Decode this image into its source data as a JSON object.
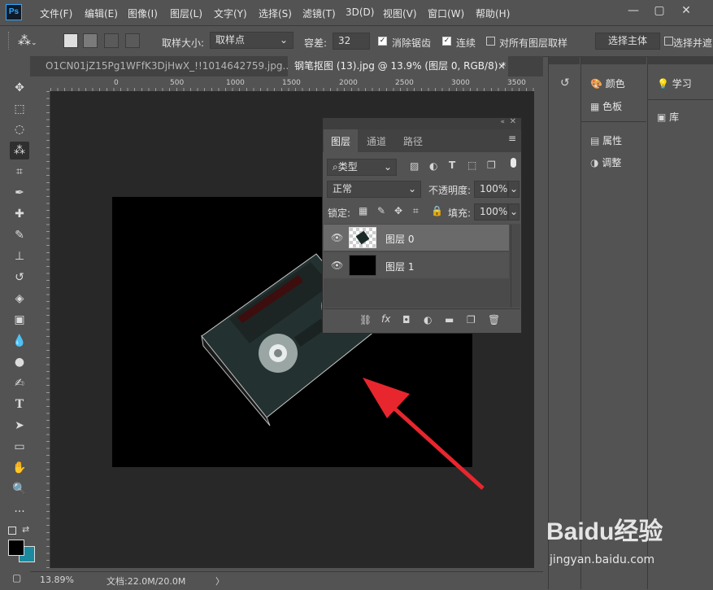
{
  "app": {
    "logo": "Ps"
  },
  "menu": [
    "文件(F)",
    "编辑(E)",
    "图像(I)",
    "图层(L)",
    "文字(Y)",
    "选择(S)",
    "滤镜(T)",
    "3D(D)",
    "视图(V)",
    "窗口(W)",
    "帮助(H)"
  ],
  "window_controls": {
    "minimize": "—",
    "restore": "▢",
    "close": "✕"
  },
  "options": {
    "sample_size_label": "取样大小:",
    "sample_size_value": "取样点",
    "tolerance_label": "容差:",
    "tolerance_value": "32",
    "antialias_label": "消除锯齿",
    "contiguous_label": "连续",
    "sample_all_label": "对所有图层取样",
    "select_subject": "选择主体",
    "select_mask": "选择并遮"
  },
  "tabs": [
    {
      "label": "O1CN01jZ15Pg1WFfK3DjHwX_!!1014642759.jpg...",
      "close": "×"
    },
    {
      "label": "钢笔抠图 (13).jpg @ 13.9% (图层 0, RGB/8) *",
      "close": "×"
    }
  ],
  "ruler": {
    "h": [
      "0",
      "500",
      "1000",
      "1500",
      "2000",
      "2500",
      "3000",
      "3500"
    ]
  },
  "status": {
    "zoom": "13.89%",
    "doc": "文档:22.0M/20.0M",
    "arrow": "〉"
  },
  "right_panels": {
    "col1": [
      {
        "icon": "palette-icon",
        "label": "颜色"
      },
      {
        "icon": "grid-icon",
        "label": "色板"
      },
      {
        "icon": "properties-icon",
        "label": "属性"
      },
      {
        "icon": "adjust-icon",
        "label": "调整"
      }
    ],
    "col2": [
      {
        "icon": "bulb-icon",
        "label": "学习"
      },
      {
        "icon": "library-icon",
        "label": "库"
      }
    ]
  },
  "layers_panel": {
    "tabs": [
      "图层",
      "通道",
      "路径"
    ],
    "filter_type": "类型",
    "blend_mode": "正常",
    "opacity_label": "不透明度:",
    "opacity_value": "100%",
    "lock_label": "锁定:",
    "fill_label": "填充:",
    "fill_value": "100%",
    "layers": [
      {
        "name": "图层 0",
        "selected": true
      },
      {
        "name": "图层 1",
        "selected": false
      }
    ]
  },
  "watermark": {
    "brand": "Baidu经验",
    "url": "jingyan.baidu.com"
  },
  "colors": {
    "arrow": "#e8262e",
    "workspace": "#282828",
    "panel": "#535353",
    "accent": "#31a8ff"
  }
}
